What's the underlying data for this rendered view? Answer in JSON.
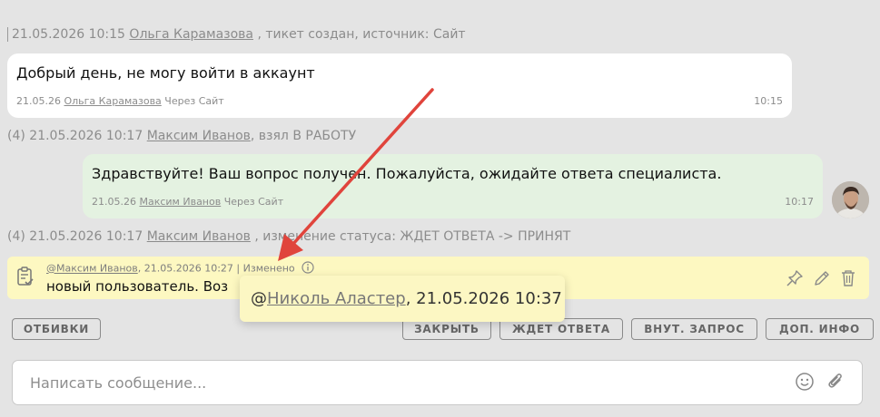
{
  "events": {
    "created": {
      "date": "21.05.2026 10:15",
      "author": "Ольга Карамазова",
      "text": ", тикет создан, источник: Сайт"
    },
    "taken": {
      "prefix": "(4) 21.05.2026 10:17",
      "author": "Максим Иванов",
      "text": ", взял В РАБОТУ"
    },
    "status": {
      "prefix": "(4) 21.05.2026 10:17",
      "author": "Максим Иванов",
      "text": ", изменение статуса: ЖДЕТ ОТВЕТА -> ПРИНЯТ"
    }
  },
  "messages": [
    {
      "text": "Добрый день, не могу войти в аккаунт",
      "date": "21.05.26",
      "author": "Ольга Карамазова",
      "via": "Через Сайт",
      "time": "10:15"
    },
    {
      "text": "Здравствуйте! Ваш вопрос получен. Пожалуйста, ожидайте ответа специалиста.",
      "date": "21.05.26",
      "author": "Максим Иванов",
      "via": "Через Сайт",
      "time": "10:17"
    }
  ],
  "note": {
    "author": "@Максим Иванов",
    "date": ", 21.05.2026 10:27",
    "separator": "|",
    "edited": "Изменено",
    "text": "новый пользователь. Воз"
  },
  "tooltip": {
    "at": "@",
    "author": "Николь Аластер",
    "date": ", 21.05.2026 10:37"
  },
  "buttons": {
    "otbivki": "ОТБИВКИ",
    "close": "ЗАКРЫТЬ",
    "waiting": "ЖДЕТ ОТВЕТА",
    "internal": "ВНУТ. ЗАПРОС",
    "more_info": "ДОП. ИНФО"
  },
  "composer": {
    "placeholder": "Написать сообщение..."
  },
  "colors": {
    "client_bubble": "#ffffff",
    "agent_bubble": "#e4f2e1",
    "note_bg": "#fdf8c1",
    "arrow": "#e0443c"
  }
}
